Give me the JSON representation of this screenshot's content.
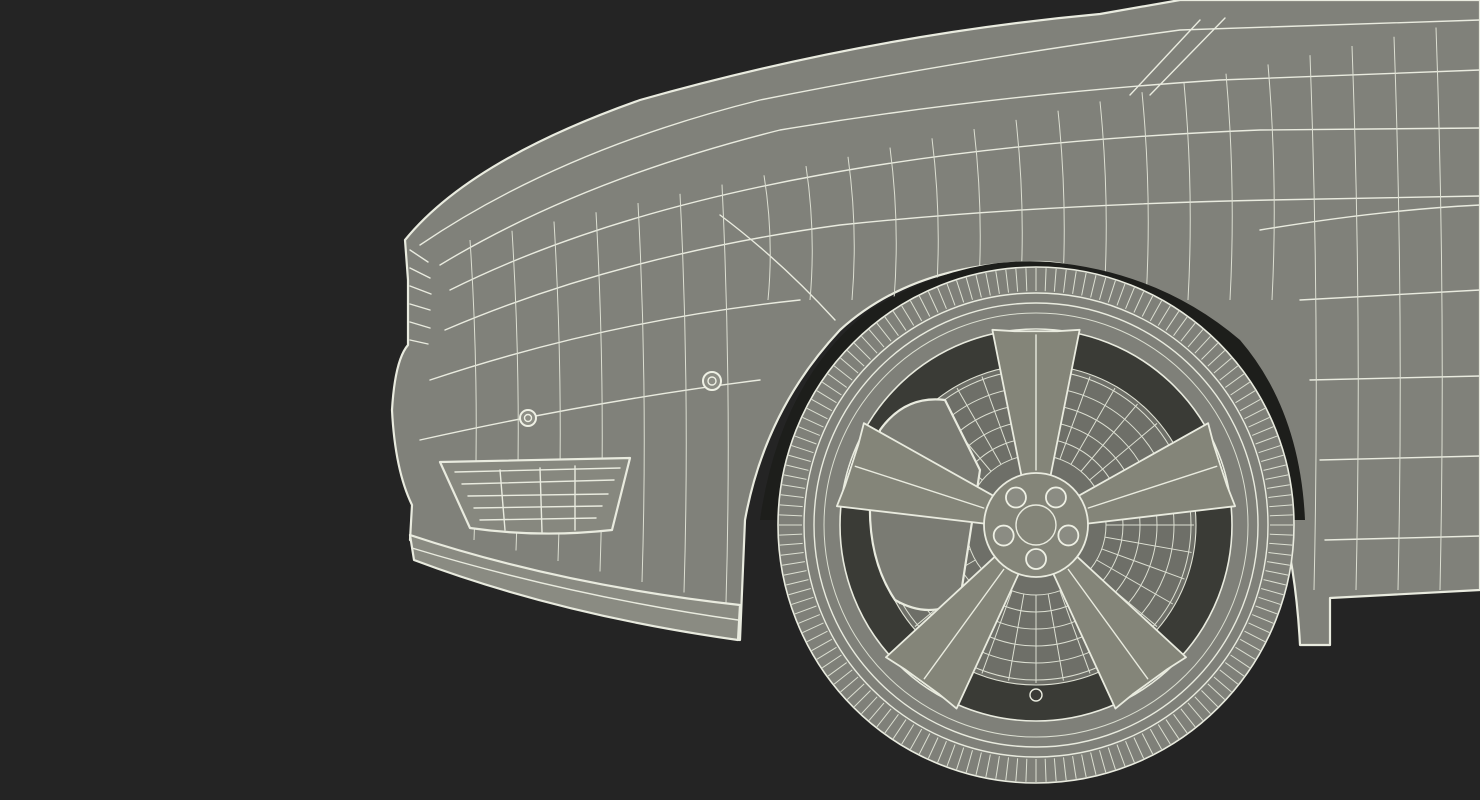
{
  "scene": {
    "background": "#242424",
    "mesh_color": "#80817a",
    "wire_color": "#e9ebdf"
  }
}
